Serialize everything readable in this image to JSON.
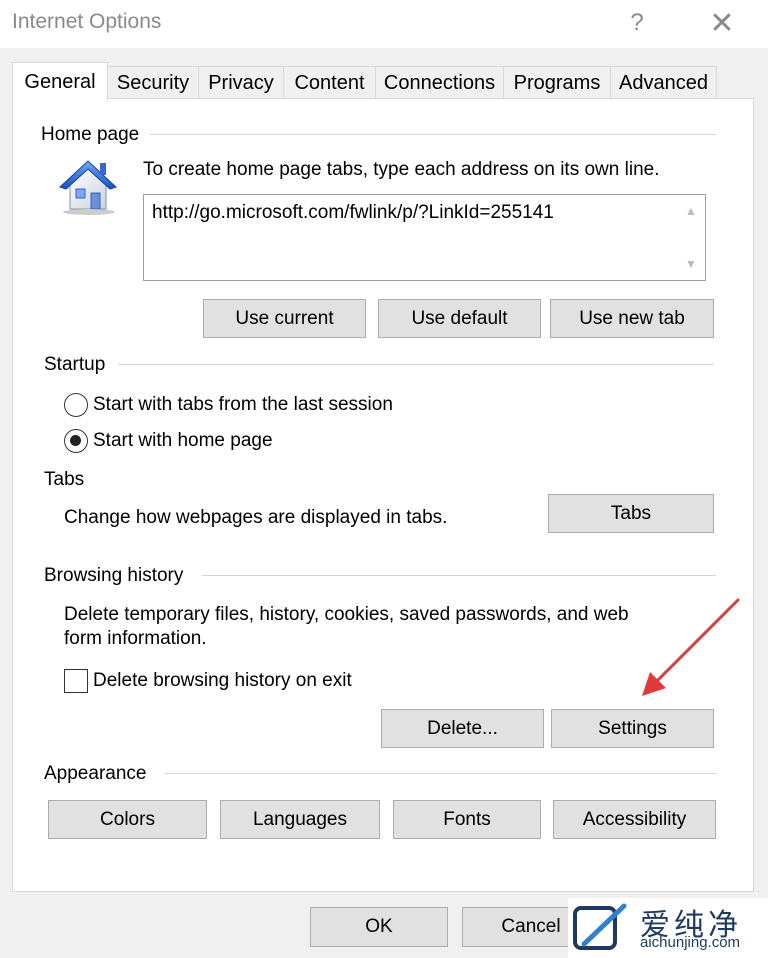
{
  "window": {
    "title": "Internet Options",
    "help": "?",
    "close": "✕"
  },
  "tabs": [
    {
      "label": "General",
      "active": true
    },
    {
      "label": "Security"
    },
    {
      "label": "Privacy"
    },
    {
      "label": "Content"
    },
    {
      "label": "Connections"
    },
    {
      "label": "Programs"
    },
    {
      "label": "Advanced"
    }
  ],
  "home_page": {
    "group_label": "Home page",
    "instructions": "To create home page tabs, type each address on its own line.",
    "address_value": "http://go.microsoft.com/fwlink/p/?LinkId=255141",
    "icon": "house-icon",
    "use_current": "Use current",
    "use_default": "Use default",
    "use_new_tab": "Use new tab"
  },
  "startup": {
    "group_label": "Startup",
    "option_last_session": "Start with tabs from the last session",
    "option_home_page": "Start with home page",
    "selected": "option_home_page"
  },
  "tabs_section": {
    "group_label": "Tabs",
    "description": "Change how webpages are displayed in tabs.",
    "button": "Tabs"
  },
  "browsing_history": {
    "group_label": "Browsing history",
    "description": "Delete temporary files, history, cookies, saved passwords, and web form information.",
    "delete_on_exit": "Delete browsing history on exit",
    "delete_on_exit_checked": false,
    "delete_button": "Delete...",
    "settings_button": "Settings"
  },
  "appearance": {
    "group_label": "Appearance",
    "colors": "Colors",
    "languages": "Languages",
    "fonts": "Fonts",
    "accessibility": "Accessibility"
  },
  "footer": {
    "ok": "OK",
    "cancel": "Cancel"
  },
  "watermark": {
    "name": "爱纯净",
    "url": "aichunjing.com"
  },
  "colors": {
    "annotation_arrow": "#e03a3a",
    "button_bg": "#e1e1e1",
    "watermark": "#1e3a5f"
  }
}
